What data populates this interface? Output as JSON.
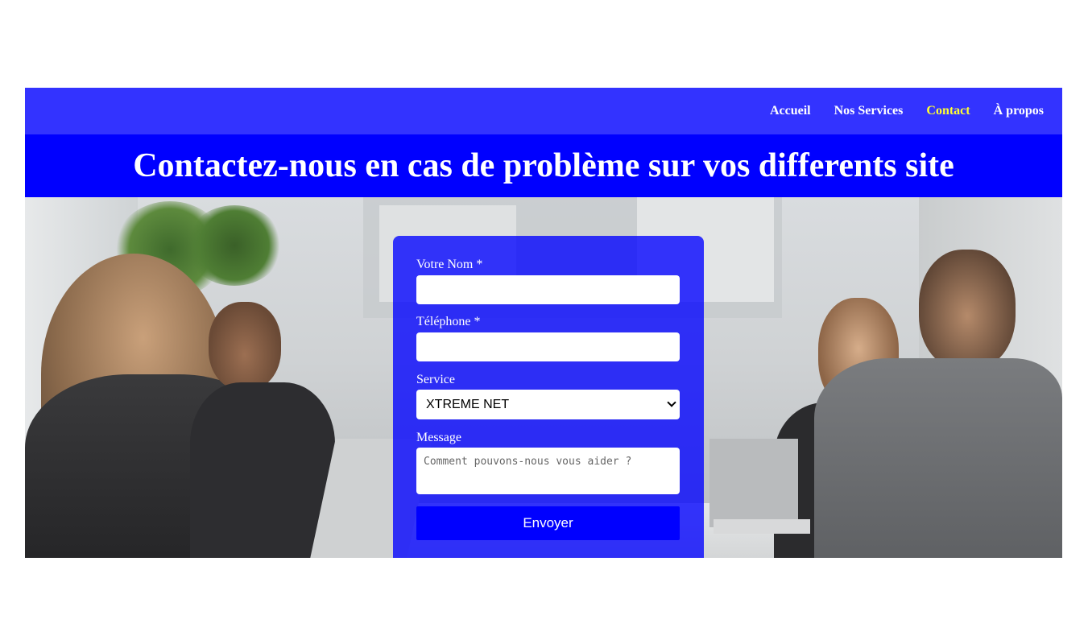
{
  "nav": {
    "items": [
      {
        "label": "Accueil",
        "active": false
      },
      {
        "label": "Nos Services",
        "active": false
      },
      {
        "label": "Contact",
        "active": true
      },
      {
        "label": "À propos",
        "active": false
      }
    ]
  },
  "hero": {
    "title": "Contactez-nous en cas de problème sur vos differents site"
  },
  "form": {
    "name_label": "Votre Nom *",
    "name_value": "",
    "phone_label": "Téléphone *",
    "phone_value": "",
    "service_label": "Service",
    "service_selected": "XTREME NET",
    "message_label": "Message",
    "message_placeholder": "Comment pouvons-nous vous aider ?",
    "submit_label": "Envoyer"
  },
  "colors": {
    "nav_bg": "#3333ff",
    "title_bg": "#0000ff",
    "active_link": "#ffff33",
    "form_panel": "rgba(0,0,255,0.78)",
    "button": "#0000ff"
  }
}
